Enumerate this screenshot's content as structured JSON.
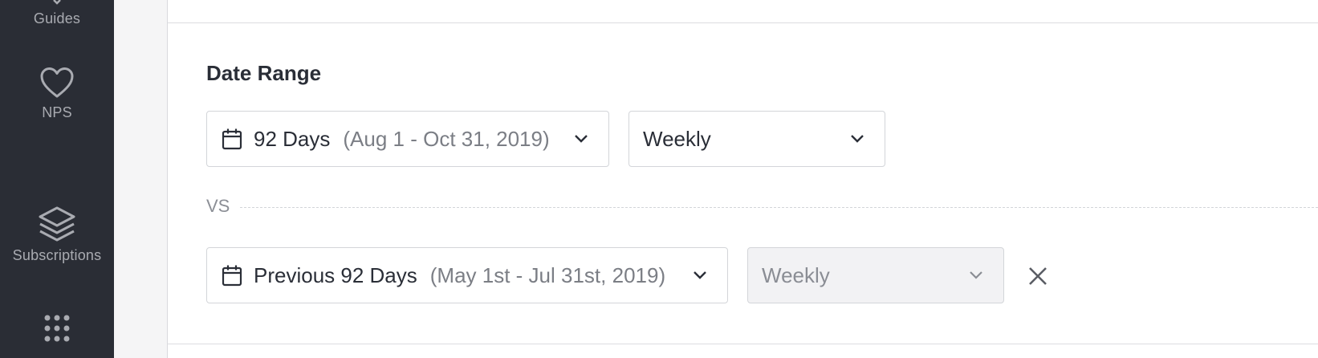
{
  "sidebar": {
    "items": [
      {
        "label": "Guides",
        "icon": "guides-icon"
      },
      {
        "label": "NPS",
        "icon": "heart-icon"
      },
      {
        "label": "Subscriptions",
        "icon": "layers-icon"
      },
      {
        "label": "",
        "icon": "apps-grid-icon"
      }
    ]
  },
  "date_range": {
    "title": "Date Range",
    "primary": {
      "range_label": "92 Days",
      "range_detail": "(Aug 1 - Oct 31, 2019)",
      "interval": "Weekly"
    },
    "separator": "VS",
    "comparison": {
      "range_label": "Previous 92 Days",
      "range_detail": "(May 1st - Jul 31st, 2019)",
      "interval": "Weekly",
      "interval_disabled": true
    }
  },
  "colors": {
    "sidebar_bg": "#2a2d35",
    "sidebar_text": "#a9abb1",
    "text": "#2a2e37",
    "muted": "#7b7e85",
    "border": "#d3d5d9"
  }
}
